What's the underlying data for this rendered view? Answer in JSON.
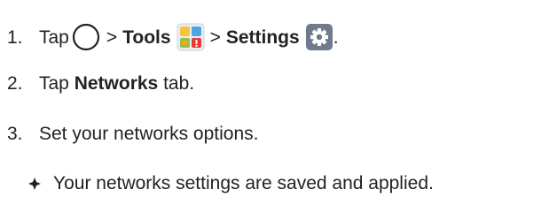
{
  "steps": [
    {
      "number": "1.",
      "tap": "Tap",
      "sep1": ">",
      "tools": "Tools",
      "sep2": ">",
      "settings": "Settings",
      "end": "."
    },
    {
      "number": "2.",
      "prefix": "Tap",
      "bold": "Networks",
      "suffix": "tab."
    },
    {
      "number": "3.",
      "text": "Set your networks options."
    }
  ],
  "bullet": {
    "icon": "diamond-bullet-icon",
    "text": "Your networks settings are saved and applied."
  },
  "icons": {
    "home": "home-circle-icon",
    "tools": "tools-folder-icon",
    "settings": "settings-gear-icon"
  },
  "colors": {
    "text": "#222222",
    "settings_icon_bg": "#6d7b8c",
    "tools_green": "#8bc34a",
    "tools_blue": "#4fa3e0",
    "tools_red": "#e53935",
    "tools_orange": "#f5a623"
  }
}
